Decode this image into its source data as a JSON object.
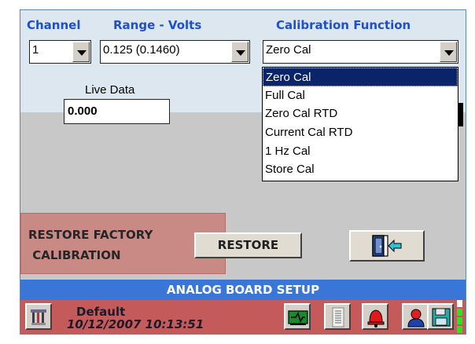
{
  "headers": {
    "channel": "Channel",
    "range": "Range - Volts",
    "calibration": "Calibration Function"
  },
  "channel_select": {
    "value": "1"
  },
  "range_select": {
    "value": "0.125  (0.1460)"
  },
  "calibration_select": {
    "value": "Zero Cal",
    "options": [
      "Zero Cal",
      "Full Cal",
      "Zero Cal RTD",
      "Current Cal RTD",
      "1 Hz Cal",
      "Store Cal"
    ]
  },
  "live_data": {
    "label": "Live Data",
    "value": "0.000"
  },
  "restore": {
    "title": "RESTORE FACTORY\n CALIBRATION",
    "button_label": "RESTORE"
  },
  "title_bar": {
    "label": "ANALOG BOARD SETUP"
  },
  "status": {
    "profile": "Default",
    "datetime": "10/12/2007 10:13:51"
  },
  "icons": {
    "settings": "tools-icon",
    "exit": "exit-door-icon",
    "network": "network-board-icon",
    "list": "list-icon",
    "alarm": "alarm-bell-icon",
    "user": "user-icon",
    "save": "save-disk-icon"
  },
  "colors": {
    "header_text": "#1f4fcf",
    "top_panel": "#dde7f0",
    "gray_panel": "#c8c8c8",
    "restore_panel": "#c98a86",
    "title_bar": "#3a76d8",
    "status_bar": "#c55a5a",
    "selection": "#0a246a",
    "led_green": "#22e81e"
  }
}
